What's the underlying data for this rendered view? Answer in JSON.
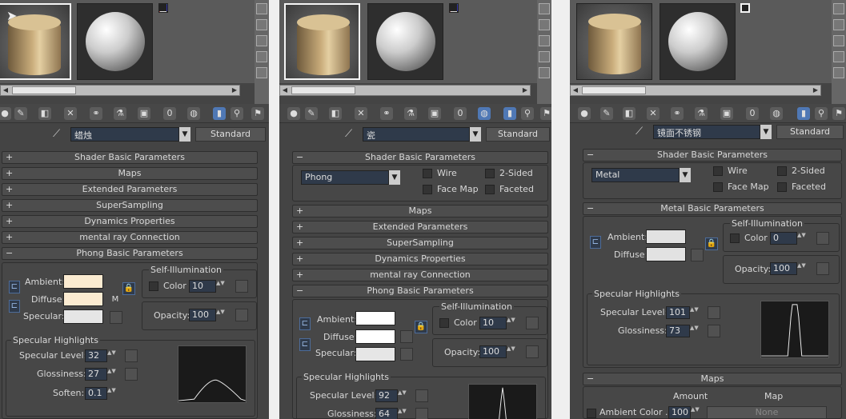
{
  "panels": [
    {
      "material_name": "蜡烛",
      "material_type": "Standard",
      "rollouts": [
        "Shader Basic Parameters",
        "Maps",
        "Extended Parameters",
        "SuperSampling",
        "Dynamics Properties",
        "mental ray Connection",
        "Phong Basic Parameters"
      ],
      "phong": {
        "ambient_label": "Ambient:",
        "diffuse_label": "Diffuse:",
        "specular_label": "Specular:",
        "map_button": "M",
        "self_illum_title": "Self-Illumination",
        "color_label": "Color",
        "color_value": "10",
        "opacity_label": "Opacity:",
        "opacity_value": "100",
        "colors": {
          "ambient": "#fbebd1",
          "diffuse": "#fbebd1",
          "specular": "#e6e6e6"
        },
        "highlights_title": "Specular Highlights",
        "spec_level_label": "Specular Level:",
        "spec_level": "32",
        "glossiness_label": "Glossiness:",
        "glossiness": "27",
        "soften_label": "Soften:",
        "soften": "0.1"
      }
    },
    {
      "material_name": "瓷",
      "material_type": "Standard",
      "shader_rollout": "Shader Basic Parameters",
      "shader": "Phong",
      "options": {
        "wire": "Wire",
        "two_sided": "2-Sided",
        "face_map": "Face Map",
        "faceted": "Faceted"
      },
      "rollouts": [
        "Maps",
        "Extended Parameters",
        "SuperSampling",
        "Dynamics Properties",
        "mental ray Connection",
        "Phong Basic Parameters"
      ],
      "phong": {
        "ambient_label": "Ambient:",
        "diffuse_label": "Diffuse:",
        "specular_label": "Specular:",
        "self_illum_title": "Self-Illumination",
        "color_label": "Color",
        "color_value": "10",
        "opacity_label": "Opacity:",
        "opacity_value": "100",
        "colors": {
          "ambient": "#ffffff",
          "diffuse": "#ffffff",
          "specular": "#e6e6e6"
        },
        "highlights_title": "Specular Highlights",
        "spec_level_label": "Specular Level:",
        "spec_level": "92",
        "glossiness_label": "Glossiness:",
        "glossiness": "64"
      }
    },
    {
      "material_name": "镜面不锈钢",
      "material_type": "Standard",
      "shader_rollout": "Shader Basic Parameters",
      "shader": "Metal",
      "options": {
        "wire": "Wire",
        "two_sided": "2-Sided",
        "face_map": "Face Map",
        "faceted": "Faceted"
      },
      "metal_rollout": "Metal Basic Parameters",
      "metal": {
        "ambient_label": "Ambient:",
        "diffuse_label": "Diffuse:",
        "self_illum_title": "Self-Illumination",
        "color_label": "Color",
        "color_value": "0",
        "opacity_label": "Opacity:",
        "opacity_value": "100",
        "colors": {
          "ambient": "#e2e2e2",
          "diffuse": "#e2e2e2"
        },
        "highlights_title": "Specular Highlights",
        "spec_level_label": "Specular Level:",
        "spec_level": "101",
        "glossiness_label": "Glossiness:",
        "glossiness": "73"
      },
      "maps_rollout": "Maps",
      "maps": {
        "amount_header": "Amount",
        "map_header": "Map",
        "row_label": "Ambient Color . . .",
        "row_amount": "100",
        "row_map": "None"
      }
    }
  ]
}
